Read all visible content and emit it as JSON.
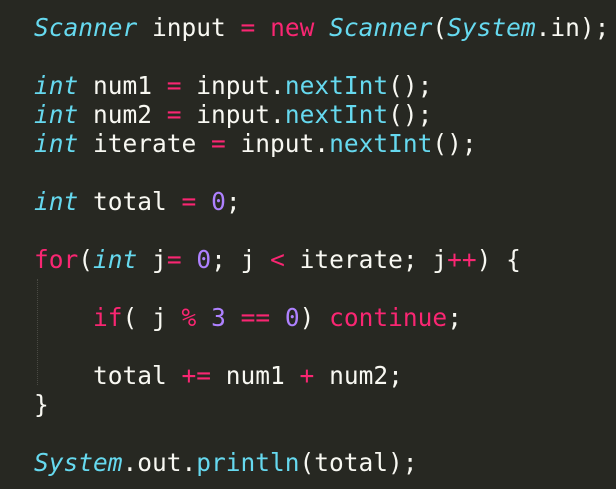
{
  "code": {
    "lines": [
      [
        {
          "t": "Scanner",
          "c": "tok-type"
        },
        {
          "t": " input ",
          "c": "tok-plain"
        },
        {
          "t": "=",
          "c": "tok-op"
        },
        {
          "t": " ",
          "c": "tok-plain"
        },
        {
          "t": "new",
          "c": "tok-kw"
        },
        {
          "t": " ",
          "c": "tok-plain"
        },
        {
          "t": "Scanner",
          "c": "tok-type"
        },
        {
          "t": "(",
          "c": "tok-plain"
        },
        {
          "t": "System",
          "c": "tok-type"
        },
        {
          "t": ".in);",
          "c": "tok-plain"
        }
      ],
      [
        {
          "t": "int",
          "c": "tok-type"
        },
        {
          "t": " num1 ",
          "c": "tok-plain"
        },
        {
          "t": "=",
          "c": "tok-op"
        },
        {
          "t": " input.",
          "c": "tok-plain"
        },
        {
          "t": "nextInt",
          "c": "tok-fn"
        },
        {
          "t": "();",
          "c": "tok-plain"
        }
      ],
      [
        {
          "t": "int",
          "c": "tok-type"
        },
        {
          "t": " num2 ",
          "c": "tok-plain"
        },
        {
          "t": "=",
          "c": "tok-op"
        },
        {
          "t": " input.",
          "c": "tok-plain"
        },
        {
          "t": "nextInt",
          "c": "tok-fn"
        },
        {
          "t": "();",
          "c": "tok-plain"
        }
      ],
      [
        {
          "t": "int",
          "c": "tok-type"
        },
        {
          "t": " iterate ",
          "c": "tok-plain"
        },
        {
          "t": "=",
          "c": "tok-op"
        },
        {
          "t": " input.",
          "c": "tok-plain"
        },
        {
          "t": "nextInt",
          "c": "tok-fn"
        },
        {
          "t": "();",
          "c": "tok-plain"
        }
      ],
      [
        {
          "t": "int",
          "c": "tok-type"
        },
        {
          "t": " total ",
          "c": "tok-plain"
        },
        {
          "t": "=",
          "c": "tok-op"
        },
        {
          "t": " ",
          "c": "tok-plain"
        },
        {
          "t": "0",
          "c": "tok-num"
        },
        {
          "t": ";",
          "c": "tok-plain"
        }
      ],
      [
        {
          "t": "for",
          "c": "tok-kw"
        },
        {
          "t": "(",
          "c": "tok-plain"
        },
        {
          "t": "int",
          "c": "tok-type"
        },
        {
          "t": " j",
          "c": "tok-plain"
        },
        {
          "t": "=",
          "c": "tok-op"
        },
        {
          "t": " ",
          "c": "tok-plain"
        },
        {
          "t": "0",
          "c": "tok-num"
        },
        {
          "t": "; j ",
          "c": "tok-plain"
        },
        {
          "t": "<",
          "c": "tok-op"
        },
        {
          "t": " iterate; j",
          "c": "tok-plain"
        },
        {
          "t": "++",
          "c": "tok-op"
        },
        {
          "t": ") {",
          "c": "tok-plain"
        }
      ],
      [
        {
          "t": "    ",
          "c": "tok-plain"
        },
        {
          "t": "if",
          "c": "tok-kw"
        },
        {
          "t": "( j ",
          "c": "tok-plain"
        },
        {
          "t": "%",
          "c": "tok-op"
        },
        {
          "t": " ",
          "c": "tok-plain"
        },
        {
          "t": "3",
          "c": "tok-num"
        },
        {
          "t": " ",
          "c": "tok-plain"
        },
        {
          "t": "==",
          "c": "tok-op"
        },
        {
          "t": " ",
          "c": "tok-plain"
        },
        {
          "t": "0",
          "c": "tok-num"
        },
        {
          "t": ") ",
          "c": "tok-plain"
        },
        {
          "t": "continue",
          "c": "tok-kw"
        },
        {
          "t": ";",
          "c": "tok-plain"
        }
      ],
      [
        {
          "t": "    total ",
          "c": "tok-plain"
        },
        {
          "t": "+=",
          "c": "tok-op"
        },
        {
          "t": " num1 ",
          "c": "tok-plain"
        },
        {
          "t": "+",
          "c": "tok-op"
        },
        {
          "t": " num2;",
          "c": "tok-plain"
        }
      ],
      [
        {
          "t": "}",
          "c": "tok-plain"
        }
      ],
      [
        {
          "t": "System",
          "c": "tok-type"
        },
        {
          "t": ".out.",
          "c": "tok-plain"
        },
        {
          "t": "println",
          "c": "tok-fn"
        },
        {
          "t": "(total);",
          "c": "tok-plain"
        }
      ]
    ]
  },
  "colors": {
    "background": "#272822",
    "plain": "#f8f8f2",
    "type": "#66d9ef",
    "keyword": "#f92672",
    "number": "#ae81ff"
  }
}
